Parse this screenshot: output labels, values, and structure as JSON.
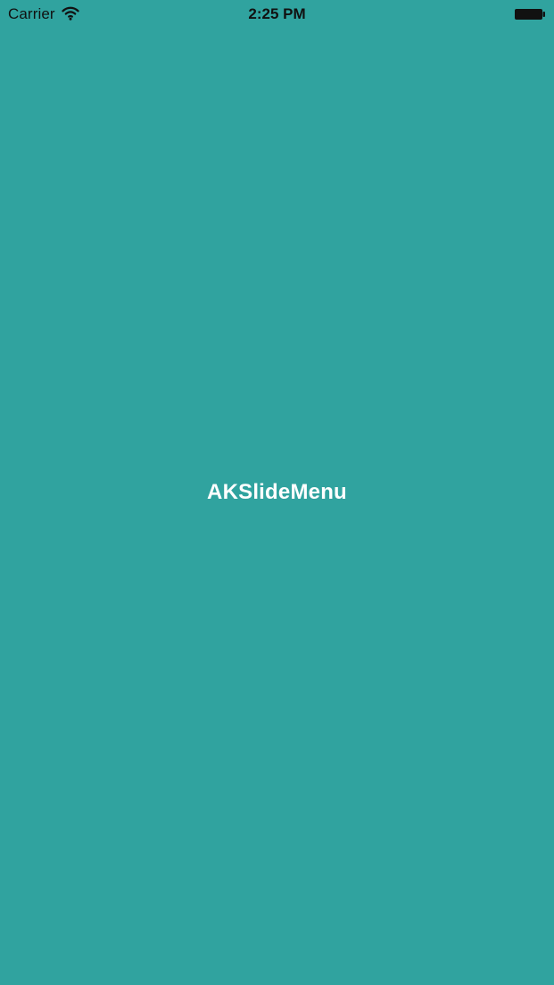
{
  "colors": {
    "background": "#30A39F",
    "title_text": "#FFFFFF",
    "status_text": "#111111"
  },
  "status_bar": {
    "carrier": "Carrier",
    "time": "2:25 PM",
    "icons": {
      "wifi": "wifi-icon",
      "battery": "battery-icon"
    }
  },
  "main": {
    "title": "AKSlideMenu"
  }
}
